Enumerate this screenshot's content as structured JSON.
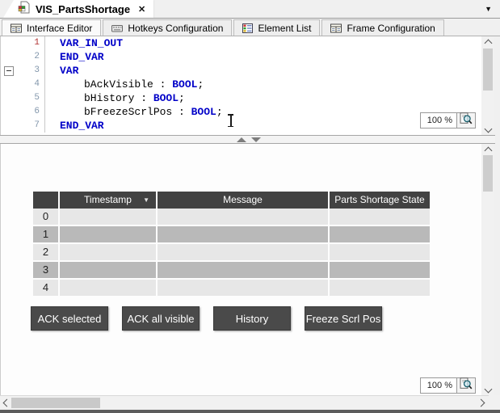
{
  "window": {
    "doc_tab": {
      "title": "VIS_PartsShortage"
    },
    "icons": {
      "close": "✕",
      "tab_list_dropdown": "▼",
      "sort_desc": "▼"
    }
  },
  "editor_tabs": [
    {
      "label": "Interface Editor",
      "icon": "form-icon",
      "active": true
    },
    {
      "label": "Hotkeys Configuration",
      "icon": "keyboard-icon",
      "active": false
    },
    {
      "label": "Element List",
      "icon": "grid-icon",
      "active": false
    },
    {
      "label": "Frame Configuration",
      "icon": "form-icon",
      "active": false
    }
  ],
  "code_editor": {
    "zoom_label": "100 %",
    "lines": [
      {
        "num": "1",
        "indent": 1,
        "fold": false,
        "tokens": [
          [
            "VAR_IN_OUT",
            "k"
          ]
        ]
      },
      {
        "num": "2",
        "indent": 1,
        "fold": false,
        "tokens": [
          [
            "END_VAR",
            "k"
          ]
        ]
      },
      {
        "num": "3",
        "indent": 1,
        "fold": true,
        "tokens": [
          [
            "VAR",
            "k"
          ]
        ]
      },
      {
        "num": "4",
        "indent": 2,
        "fold": false,
        "tokens": [
          [
            "bAckVisible",
            "p"
          ],
          [
            " : ",
            "p"
          ],
          [
            "BOOL",
            "k"
          ],
          [
            ";",
            "p"
          ]
        ]
      },
      {
        "num": "5",
        "indent": 2,
        "fold": false,
        "tokens": [
          [
            "bHistory",
            "p"
          ],
          [
            " : ",
            "p"
          ],
          [
            "BOOL",
            "k"
          ],
          [
            ";",
            "p"
          ]
        ]
      },
      {
        "num": "6",
        "indent": 2,
        "fold": false,
        "tokens": [
          [
            "bFreezeScrlPos",
            "p"
          ],
          [
            " : ",
            "p"
          ],
          [
            "BOOL",
            "k"
          ],
          [
            ";",
            "p"
          ]
        ]
      },
      {
        "num": "7",
        "indent": 1,
        "fold": false,
        "tokens": [
          [
            "END_VAR",
            "k"
          ]
        ]
      }
    ]
  },
  "visualization": {
    "zoom_label": "100 %",
    "table": {
      "headers": [
        "",
        "Timestamp",
        "Message",
        "Parts Shortage State"
      ],
      "sorted_by": "Timestamp",
      "rows": [
        {
          "index": "0",
          "cells": [
            "",
            "",
            ""
          ]
        },
        {
          "index": "1",
          "cells": [
            "",
            "",
            ""
          ]
        },
        {
          "index": "2",
          "cells": [
            "",
            "",
            ""
          ]
        },
        {
          "index": "3",
          "cells": [
            "",
            "",
            ""
          ]
        },
        {
          "index": "4",
          "cells": [
            "",
            "",
            ""
          ]
        }
      ]
    },
    "buttons": [
      "ACK selected",
      "ACK all visible",
      "History",
      "Freeze Scrl Pos"
    ]
  },
  "colors": {
    "table_header_bg": "#424242",
    "row_light": "#e7e7e7",
    "row_dark": "#b9b9b9",
    "button_bg": "#4a4a4a",
    "button_text": "#ffffff",
    "keyword": "#0000c8",
    "code_text": "#000000",
    "line_number": "#8296ab",
    "line_number_active": "#b03030",
    "header_text": "#ffffff"
  }
}
